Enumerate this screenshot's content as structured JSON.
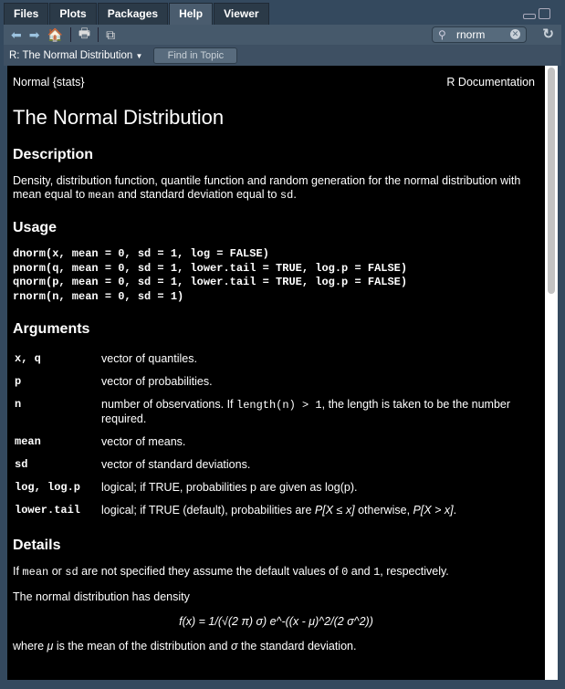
{
  "tabs": [
    "Files",
    "Plots",
    "Packages",
    "Help",
    "Viewer"
  ],
  "active_tab": "Help",
  "search": {
    "value": "rnorm"
  },
  "topic_dropdown": "R: The Normal Distribution",
  "find_in_topic": "Find in Topic",
  "doc": {
    "left_header": "Normal {stats}",
    "right_header": "R Documentation",
    "title": "The Normal Distribution",
    "description_h": "Description",
    "description": [
      "Density, distribution function, quantile function and random generation for the normal distribution with mean equal to ",
      "mean",
      " and standard deviation equal to ",
      "sd",
      "."
    ],
    "usage_h": "Usage",
    "usage": "dnorm(x, mean = 0, sd = 1, log = FALSE)\npnorm(q, mean = 0, sd = 1, lower.tail = TRUE, log.p = FALSE)\nqnorm(p, mean = 0, sd = 1, lower.tail = TRUE, log.p = FALSE)\nrnorm(n, mean = 0, sd = 1)",
    "arguments_h": "Arguments",
    "arguments": [
      {
        "k": "x, q",
        "v": "vector of quantiles."
      },
      {
        "k": "p",
        "v": "vector of probabilities."
      },
      {
        "k": "n",
        "v1": "number of observations. If ",
        "code": "length(n) > 1",
        "v2": ", the length is taken to be the number required."
      },
      {
        "k": "mean",
        "v": "vector of means."
      },
      {
        "k": "sd",
        "v": "vector of standard deviations."
      },
      {
        "k": "log, log.p",
        "v": "logical; if TRUE, probabilities p are given as log(p)."
      },
      {
        "k": "lower.tail",
        "v1": "logical; if TRUE (default), probabilities are ",
        "i1": "P[X ≤ x]",
        "v2": " otherwise, ",
        "i2": "P[X > x]",
        "v3": "."
      }
    ],
    "details_h": "Details",
    "details1": [
      "If ",
      "mean",
      " or ",
      "sd",
      " are not specified they assume the default values of ",
      "0",
      " and ",
      "1",
      ", respectively."
    ],
    "details2": "The normal distribution has density",
    "formula": "f(x) = 1/(√(2 π) σ) e^-((x - μ)^2/(2 σ^2))",
    "details3": [
      "where ",
      "μ",
      " is the mean of the distribution and ",
      "σ",
      " the standard deviation."
    ]
  }
}
